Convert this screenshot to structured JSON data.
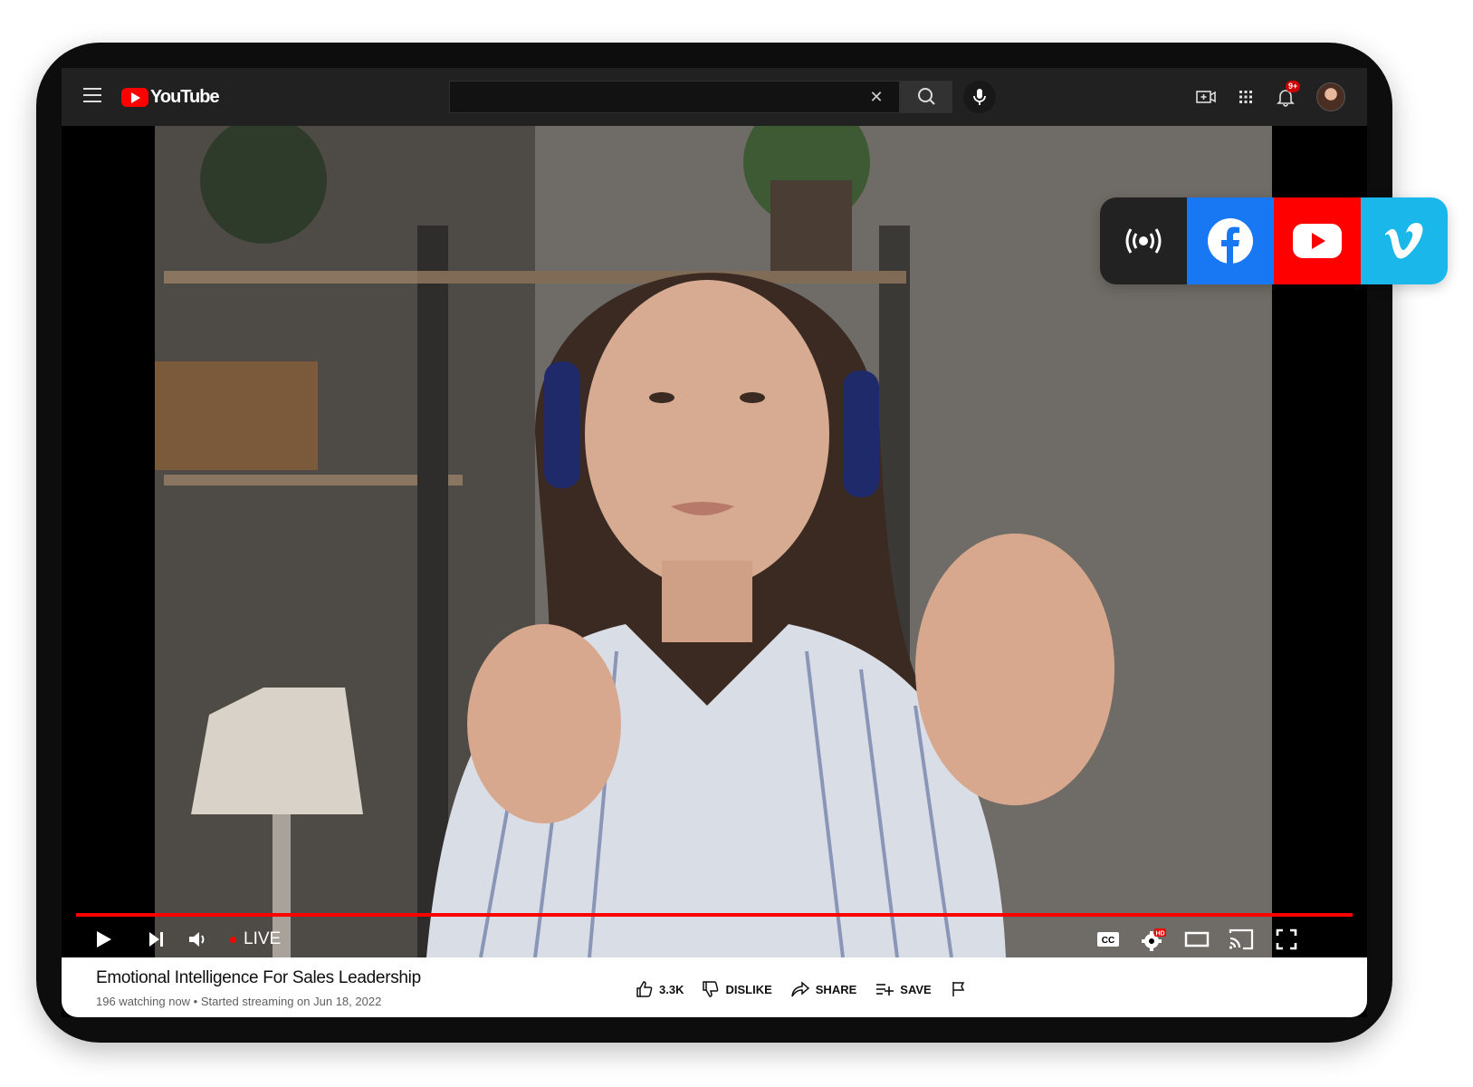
{
  "header": {
    "logo_text": "YouTube",
    "search": {
      "value": "",
      "placeholder": ""
    },
    "notification_count": "9+"
  },
  "player": {
    "live_label": "LIVE",
    "progress_fraction": 1.0,
    "colors": {
      "progress": "#ff0000",
      "live_dot": "#ff0000"
    }
  },
  "video": {
    "title": "Emotional Intelligence For Sales Leadership",
    "meta": "196 watching now • Started streaming on Jun 18, 2022"
  },
  "actions": {
    "like_count": "3.3K",
    "dislike_label": "DISLIKE",
    "share_label": "SHARE",
    "save_label": "SAVE"
  },
  "social_destinations": [
    {
      "icon": "broadcast-icon",
      "color": "#222222"
    },
    {
      "icon": "facebook-icon",
      "color": "#1877f2"
    },
    {
      "icon": "youtube-icon",
      "color": "#ff0000"
    },
    {
      "icon": "vimeo-icon",
      "color": "#1ab7ea"
    }
  ]
}
